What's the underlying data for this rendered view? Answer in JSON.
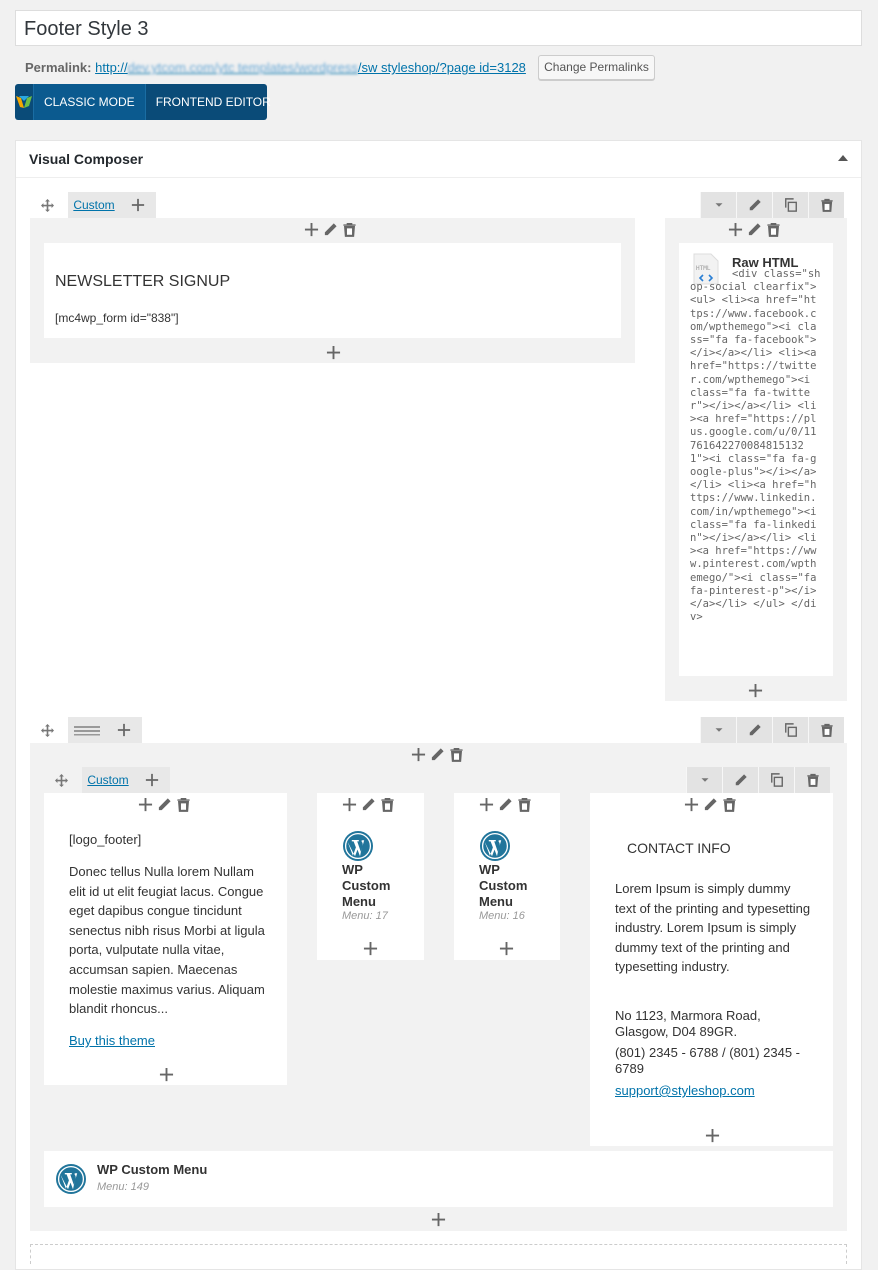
{
  "post": {
    "title": "Footer Style 3",
    "permalink_label": "Permalink:",
    "permalink_prefix": "http://",
    "permalink_blurred": "dev.ytcom.com/ytc templates/wordpress",
    "permalink_slug": "/sw styleshop/?page id=3128",
    "change_permalinks": "Change Permalinks"
  },
  "modebar": {
    "classic": "Classic Mode",
    "frontend": "Frontend Editor"
  },
  "composer": {
    "title": "Visual Composer"
  },
  "row1": {
    "tab_label": "Custom",
    "newsletter_heading": "NEWSLETTER SIGNUP",
    "newsletter_shortcode": "[mc4wp_form id=\"838\"]",
    "raw_html_title": "Raw HTML",
    "raw_html_code": "<div class=\"shop-social clearfix\"> <ul> <li><a href=\"https://www.facebook.com/wpthemego\"><i class=\"fa fa-facebook\"></i></a></li> <li><a href=\"https://twitter.com/wpthemego\"><i class=\"fa fa-twitter\"></i></a></li> <li><a href=\"https://plus.google.com/u/0/117616422700848151321\"><i class=\"fa fa-google-plus\"></i></a></li> <li><a href=\"https://www.linkedin.com/in/wpthemego\"><i class=\"fa fa-linkedin\"></i></a></li> <li><a href=\"https://www.pinterest.com/wpthemego/\"><i class=\"fa fa-pinterest-p\"></i></a></li> </ul> </div>"
  },
  "row2": {
    "inner_tab_label": "Custom",
    "col1": {
      "shortcode": "[logo_footer]",
      "text": "Donec tellus Nulla lorem Nullam elit id ut elit feugiat lacus. Congue eget dapibus congue tincidunt senectus nibh risus Morbi at ligula porta, vulputate nulla vitae, accumsan sapien. Maecenas molestie maximus varius. Aliquam blandit rhoncus...",
      "link": "Buy this theme"
    },
    "col2": {
      "title": "WP Custom Menu",
      "sub": "Menu: 17"
    },
    "col3": {
      "title": "WP Custom Menu",
      "sub": "Menu: 16"
    },
    "col4": {
      "heading": "CONTACT INFO",
      "text1": "Lorem Ipsum is simply dummy text of the printing and typesetting industry. Lorem Ipsum is simply dummy text of the printing and typesetting industry.",
      "address": "No 1123, Marmora Road, Glasgow, D04 89GR.",
      "phone": "(801) 2345 - 6788 / (801) 2345 - 6789",
      "email": "support@styleshop.com"
    },
    "bottom_menu": {
      "title": "WP Custom Menu",
      "sub": "Menu: 149"
    }
  },
  "colors": {
    "modebar": "#0a4b78",
    "link": "#0073aa",
    "wp_blue": "#21759b"
  }
}
